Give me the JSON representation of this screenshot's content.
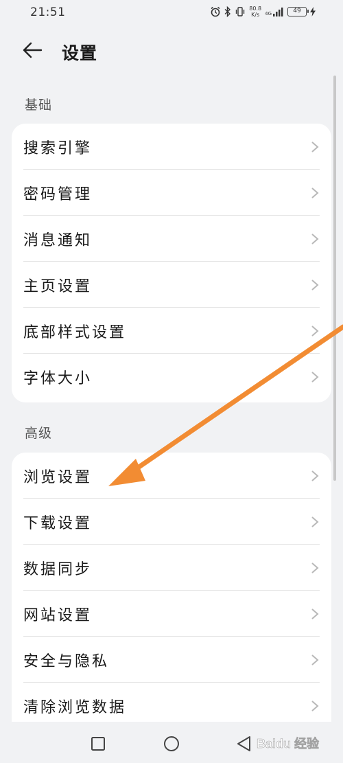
{
  "status_bar": {
    "time": "21:51",
    "net_speed_value": "80.8",
    "net_speed_unit": "K/s",
    "network_type": "4G",
    "battery_level": "49"
  },
  "header": {
    "title": "设置",
    "back_icon": "arrow-left-icon"
  },
  "sections": [
    {
      "label": "基础",
      "items": [
        "搜索引擎",
        "密码管理",
        "消息通知",
        "主页设置",
        "底部样式设置",
        "字体大小"
      ]
    },
    {
      "label": "高级",
      "items": [
        "浏览设置",
        "下载设置",
        "数据同步",
        "网站设置",
        "安全与隐私",
        "清除浏览数据"
      ]
    }
  ],
  "nav_bar": {
    "buttons": [
      "recent-apps-square-icon",
      "home-circle-icon",
      "back-triangle-icon"
    ]
  },
  "annotation": {
    "color": "#f28c33",
    "points_to": "浏览设置"
  },
  "watermark": {
    "text": "Baidu 经验"
  },
  "colors": {
    "background": "#f1f2f4",
    "card": "#ffffff",
    "text": "#1a1a1a",
    "section_label": "#555555",
    "chevron": "#b8b8b8"
  }
}
